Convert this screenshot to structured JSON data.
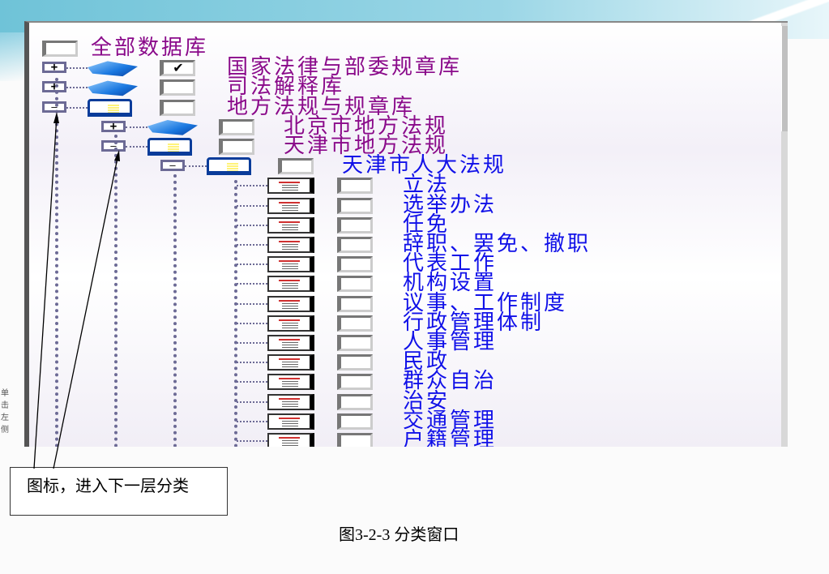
{
  "side_text": "单击左侧",
  "callout": "图标，进入下一层分类",
  "caption": "图3-2-3 分类窗口",
  "tree": {
    "all": {
      "label": "全部数据库",
      "checked": false
    },
    "nodes": [
      {
        "level": 0,
        "label": "国家法律与部委规章库",
        "expanded": false,
        "checked": true,
        "color": "purple"
      },
      {
        "level": 0,
        "label": "司法解释库",
        "expanded": false,
        "checked": false,
        "color": "purple"
      },
      {
        "level": 0,
        "label": "地方法规与规章库",
        "expanded": true,
        "checked": false,
        "color": "purple"
      },
      {
        "level": 1,
        "label": "北京市地方法规",
        "expanded": false,
        "checked": false,
        "color": "purple"
      },
      {
        "level": 1,
        "label": "天津市地方法规",
        "expanded": true,
        "checked": false,
        "color": "purple"
      },
      {
        "level": 2,
        "label": "天津市人大法规",
        "expanded": true,
        "checked": false,
        "color": "blue"
      }
    ],
    "leaves": [
      "立法",
      "选举办法",
      "任免",
      "辞职、罢免、撤职",
      "代表工作",
      "机构设置",
      "议事、工作制度",
      "行政管理体制",
      "人事管理",
      "民政",
      "群众自治",
      "治安",
      "交通管理",
      "户籍管理"
    ]
  }
}
